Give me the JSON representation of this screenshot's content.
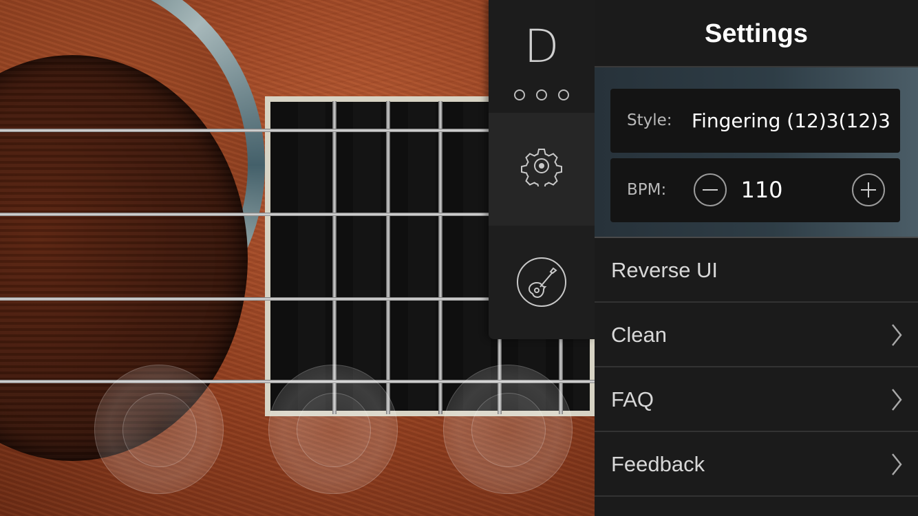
{
  "toolbar": {
    "chord": "D",
    "pattern_dots": 3
  },
  "settings": {
    "title": "Settings",
    "style_label": "Style:",
    "style_value": "Fingering (12)3(12)3",
    "bpm_label": "BPM:",
    "bpm_value": "110"
  },
  "menu": {
    "items": [
      {
        "label": "Reverse UI",
        "chevron": false
      },
      {
        "label": "Clean",
        "chevron": true
      },
      {
        "label": "FAQ",
        "chevron": true
      },
      {
        "label": "Feedback",
        "chevron": true
      }
    ]
  },
  "colors": {
    "panel_bg": "#1b1b1b",
    "toolbar_bg": "#1c1c1c",
    "wood": "#8e3d1f",
    "text_primary": "#ffffff",
    "text_secondary": "#b9b9b9"
  },
  "icons": [
    "gear-icon",
    "guitar-icon",
    "minus-icon",
    "plus-icon",
    "chevron-right-icon"
  ]
}
